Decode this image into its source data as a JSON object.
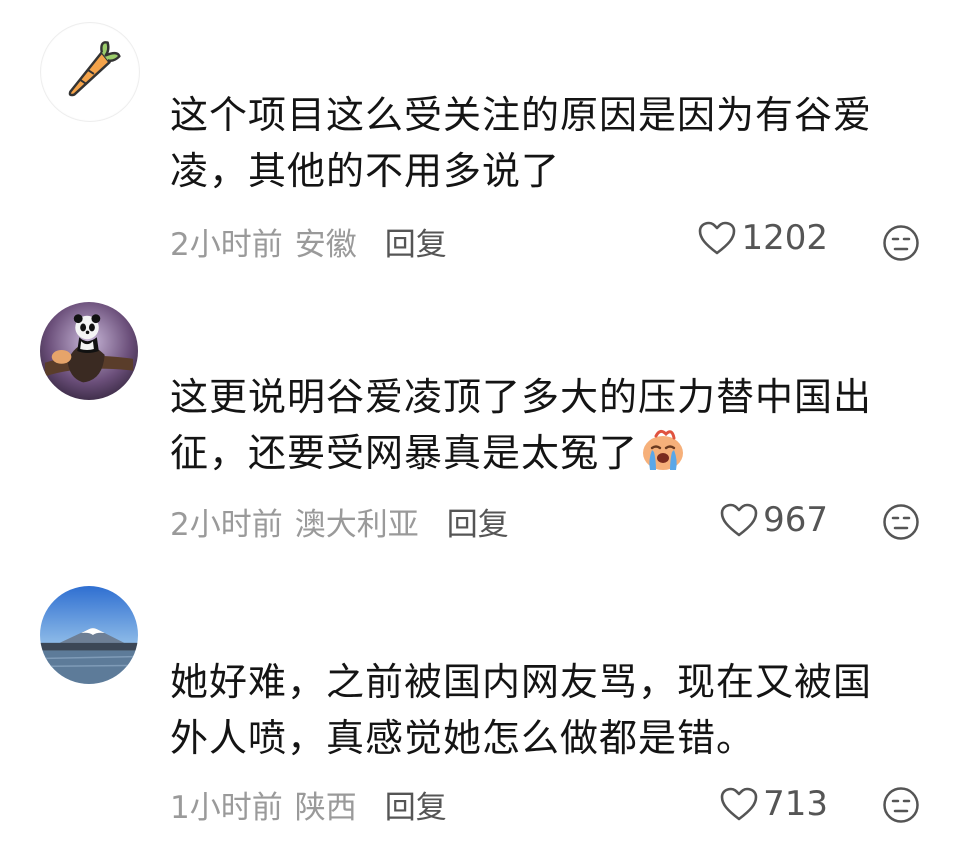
{
  "comments": [
    {
      "avatar_icon": "carrot-icon",
      "text": "这个项目这么受关注的原因是因为有谷爱凌，其他的不用多说了",
      "time": "2小时前",
      "location": "安徽",
      "reply_label": "回复",
      "likes": "1202"
    },
    {
      "avatar_icon": "panda-avatar",
      "text": "这更说明谷爱凌顶了多大的压力替中国出征，还要受网暴真是太冤了",
      "inline_emoji": "crying-face-emoji",
      "time": "2小时前",
      "location": "澳大利亚",
      "reply_label": "回复",
      "likes": "967"
    },
    {
      "avatar_icon": "mountain-avatar",
      "text": "她好难，之前被国内网友骂，现在又被国外人喷，真感觉她怎么做都是错。",
      "time": "1小时前",
      "location": "陕西",
      "reply_label": "回复",
      "likes": "713"
    }
  ]
}
